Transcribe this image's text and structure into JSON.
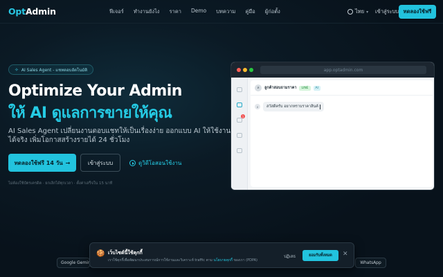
{
  "brand": {
    "logo_part1": "Opt",
    "logo_part2": "Admin"
  },
  "nav": {
    "links": [
      "ฟีเจอร์",
      "ทำงานยังไง",
      "ราคา",
      "Demo",
      "บทความ",
      "คู่มือ",
      "ผู้ก่อตั้ง"
    ],
    "language": "ไทย",
    "login": "เข้าสู่ระบบ",
    "cta": "ทดลองใช้ฟรี"
  },
  "hero": {
    "badge": "AI Sales Agent - แชทตอบอัตโนมัติ",
    "headline_line1": "Optimize Your Admin",
    "headline_line2": "ให้ AI ดูแลการขายให้คุณ",
    "subtitle_line1": "AI Sales Agent เปลี่ยนงานตอบแชทให้เป็นเรื่องง่าย ออกแบบ AI ให้ใช้งาน",
    "subtitle_line2": "ได้จริง เพิ่มโอกาสสร้างรายได้ 24 ชั่วโมง",
    "primary_button": "ทดลองใช้ฟรี 14 วัน",
    "primary_arrow": "→",
    "secondary_button": "เข้าสู่ระบบ",
    "video_button": "ดูวิดีโอสอนใช้งาน",
    "fineprint": "ไม่ต้องใช้บัตรเครดิต · ยกเลิกได้ทุกเวลา · ตั้งค่าเสร็จใน 15 นาที"
  },
  "mockup": {
    "url": "app.optadmin.com",
    "notification_count": "1",
    "chat_avatar": "ล",
    "chat_name": "ลูกค้าสอบถามราคา",
    "tag_line": "LINE",
    "tag_ai": "AI",
    "message_avatar": "ล",
    "message": "สวัสดีครับ อยากทราบราคาสินค้"
  },
  "cookie": {
    "icon": "🍪",
    "title": "เว็บไซต์นี้ใช้คุกกี้",
    "text_before_link": "เราใช้คุกกี้เพื่อพัฒนาประสบการณ์การใช้งานและวิเคราะห์ traffic ตาม",
    "link": "นโยบายคุกกี้",
    "text_after_link": "ของเรา (PDPA)",
    "reject": "ปฏิเสธ",
    "accept": "ยอมรับทั้งหมด",
    "close": "✕"
  },
  "partners": {
    "left": "Google Gemini",
    "right": "WhatsApp"
  },
  "colors": {
    "accent": "#22c3de",
    "background": "#0b1a25"
  }
}
